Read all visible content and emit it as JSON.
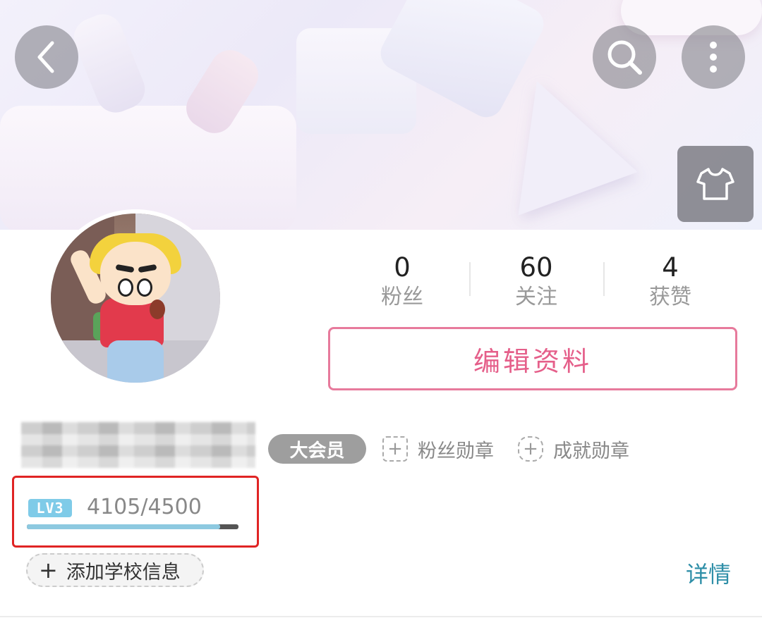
{
  "header": {
    "back_icon": "chevron-left-icon",
    "search_icon": "search-icon",
    "more_icon": "more-vertical-icon",
    "dressup_icon": "tshirt-icon"
  },
  "stats": {
    "fans": {
      "value": "0",
      "label": "粉丝"
    },
    "following": {
      "value": "60",
      "label": "关注"
    },
    "likes": {
      "value": "4",
      "label": "获赞"
    }
  },
  "edit_profile_label": "编辑资料",
  "vip_badge": "大会员",
  "medals": {
    "fans_medal": "粉丝勋章",
    "achievement_medal": "成就勋章"
  },
  "level": {
    "badge": "LV3",
    "progress_text": "4105/4500",
    "progress_fraction": 0.912
  },
  "school": {
    "add_label": "添加学校信息"
  },
  "details_label": "详情",
  "colors": {
    "accent_pink": "#e55f8a",
    "link_teal": "#2f8fa8",
    "level_blue": "#7fcbe8",
    "highlight_red": "#e02424"
  }
}
